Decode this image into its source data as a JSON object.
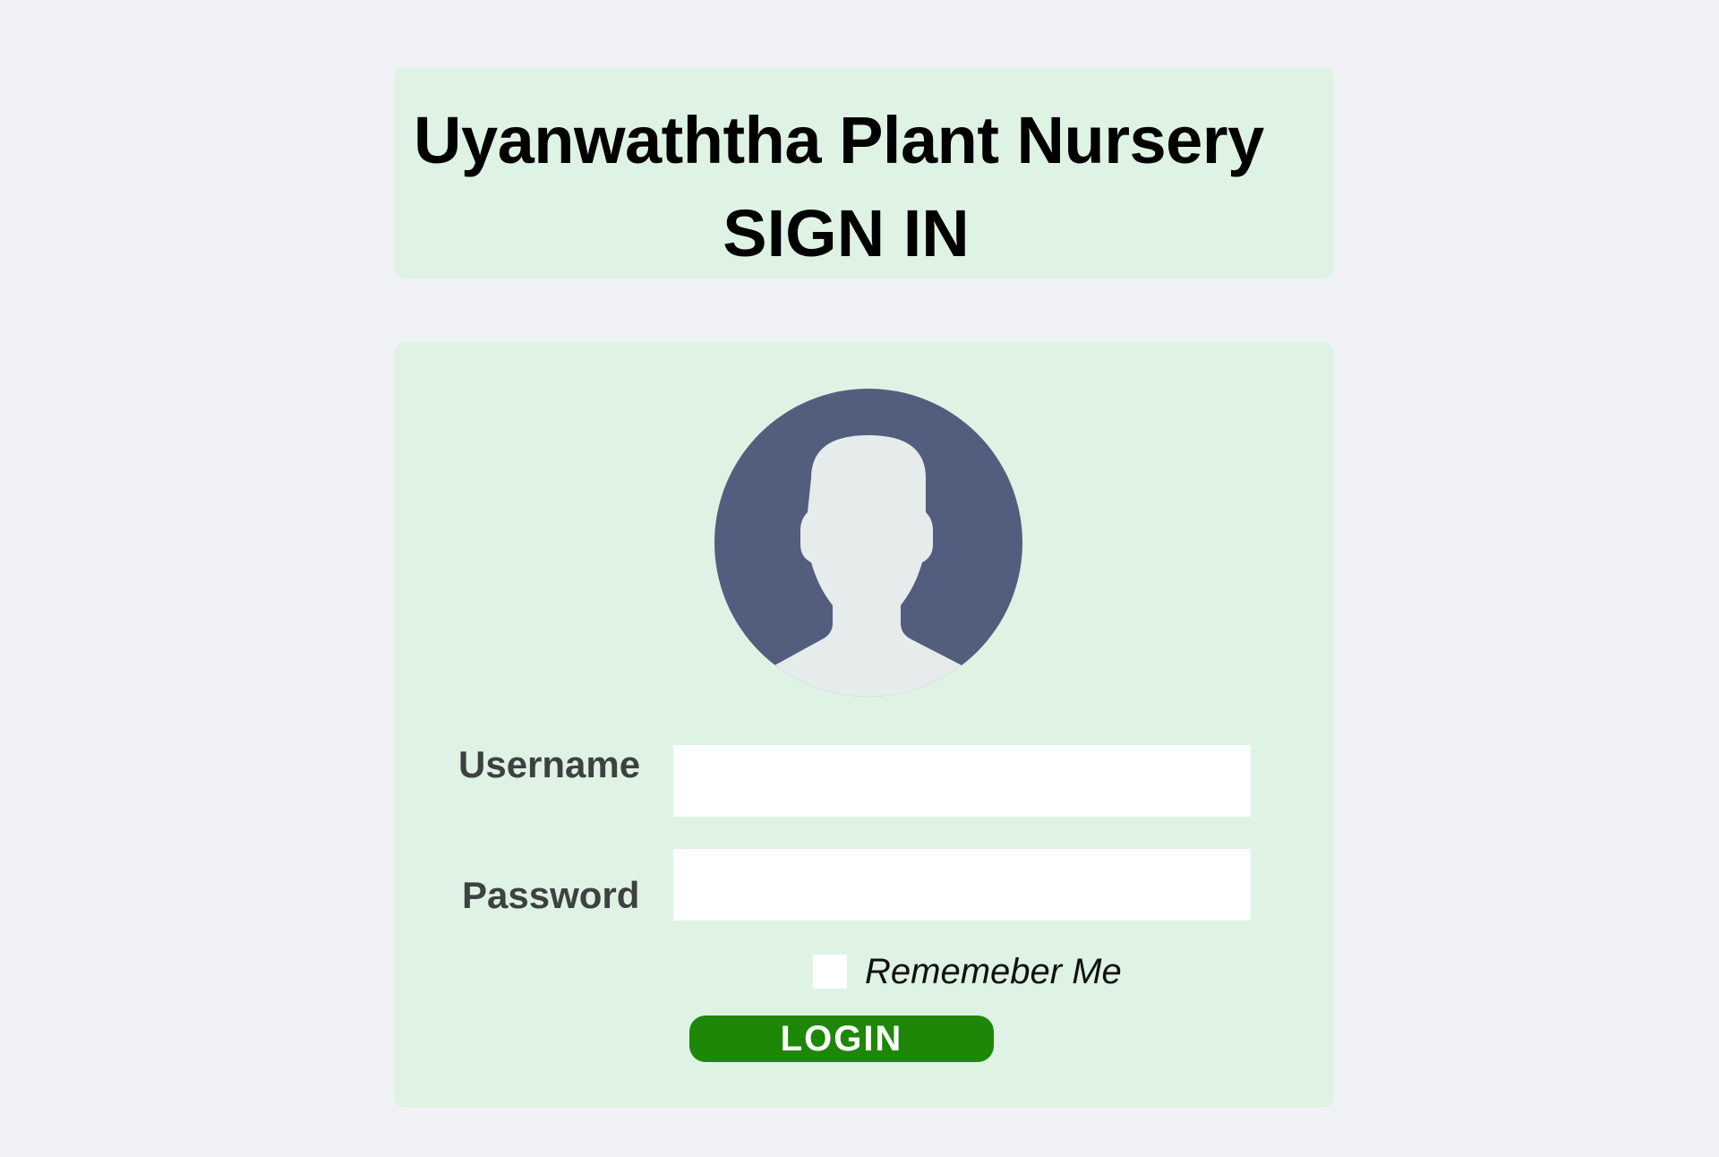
{
  "header": {
    "app_title": "Uyanwaththa Plant Nursery",
    "page_title": "SIGN IN"
  },
  "login_form": {
    "avatar_icon": "user-avatar-icon",
    "username_label": "Username",
    "username_value": "",
    "password_label": "Password",
    "password_value": "",
    "remember_label": "Rememeber Me",
    "remember_checked": false,
    "login_button_label": "LOGIN"
  },
  "colors": {
    "background": "#f1f2f6",
    "card": "#dff3e4",
    "avatar_circle": "#535e7e",
    "avatar_silhouette": "#e6ecec",
    "login_button": "#1f8708",
    "label_text": "#3d4140"
  }
}
